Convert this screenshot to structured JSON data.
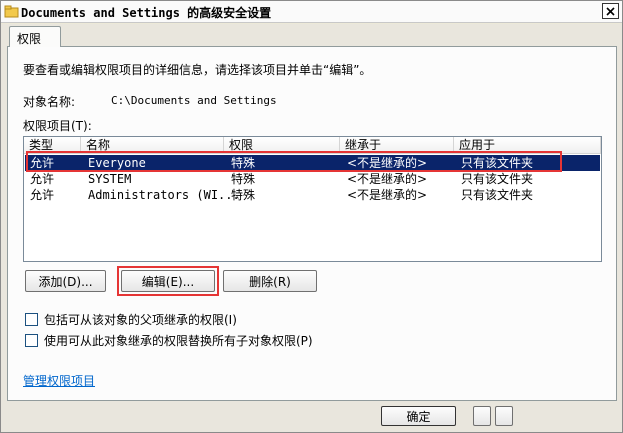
{
  "window": {
    "title": "Documents and Settings 的高级安全设置"
  },
  "tabs": [
    {
      "label": "权限"
    }
  ],
  "main": {
    "instruction": "要查看或编辑权限项目的详细信息，请选择该项目并单击“编辑”。",
    "object_name_label": "对象名称:",
    "object_name_value": "C:\\Documents and Settings",
    "entries_label": "权限项目(T):"
  },
  "permissions_table": {
    "columns": [
      "类型",
      "名称",
      "权限",
      "继承于",
      "应用于"
    ],
    "rows": [
      {
        "type": "允许",
        "name": "Everyone",
        "permission": "特殊",
        "inherited_from": "<不是继承的>",
        "applies_to": "只有该文件夹",
        "selected": true
      },
      {
        "type": "允许",
        "name": "SYSTEM",
        "permission": "特殊",
        "inherited_from": "<不是继承的>",
        "applies_to": "只有该文件夹",
        "selected": false
      },
      {
        "type": "允许",
        "name": "Administrators (WI...",
        "permission": "特殊",
        "inherited_from": "<不是继承的>",
        "applies_to": "只有该文件夹",
        "selected": false
      }
    ]
  },
  "buttons": {
    "add": "添加(D)...",
    "edit": "编辑(E)...",
    "remove": "删除(R)",
    "ok": "确定"
  },
  "checkboxes": {
    "include_inheritable": "包括可从该对象的父项继承的权限(I)",
    "replace_child": "使用可从此对象继承的权限替换所有子对象权限(P)"
  },
  "links": {
    "manage_entries": "管理权限项目"
  },
  "colors": {
    "selection": "#0a246a",
    "highlight_box": "#e53535",
    "link": "#0066cc"
  }
}
